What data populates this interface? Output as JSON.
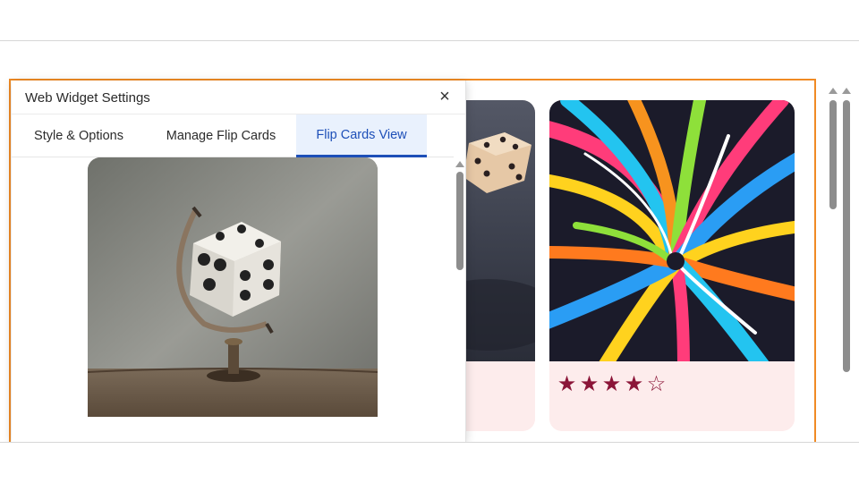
{
  "dialog": {
    "title": "Web Widget Settings",
    "close_label": "×",
    "tabs": [
      {
        "label": "Style & Options",
        "active": false
      },
      {
        "label": "Manage Flip Cards",
        "active": false
      },
      {
        "label": "Flip Cards View",
        "active": true
      }
    ]
  },
  "cards": [
    {
      "image": "dice-on-dark-fabric"
    },
    {
      "image": "colorful-swirl-art",
      "rating": 4,
      "rating_max": 5
    }
  ],
  "preview": {
    "image": "dice-globe"
  },
  "colors": {
    "canvas_border": "#f08a24",
    "active_tab": "#1d4fb8",
    "active_tab_bg": "#e9f1fd",
    "star": "#8b1538",
    "card_body": "#fdecec"
  }
}
